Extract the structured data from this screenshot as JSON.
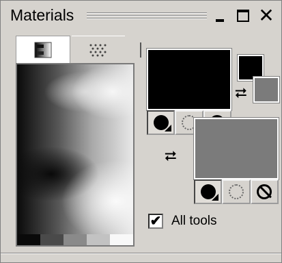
{
  "window": {
    "title": "Materials",
    "min_label": "",
    "close_label": "✕"
  },
  "tabs": [
    {
      "name": "gradient",
      "icon": "gradient-icon",
      "active": true
    },
    {
      "name": "pattern",
      "icon": "pattern-icon",
      "active": false
    }
  ],
  "gradient": {
    "swatches": [
      "#0a0a0a",
      "#4a4a4a",
      "#8a8a8a",
      "#c2c2c2",
      "#f8f8f8"
    ]
  },
  "foreground": {
    "color": "#000000",
    "tools": [
      {
        "name": "solid-color",
        "icon": "solid-circle-icon",
        "active": true
      },
      {
        "name": "gradient",
        "icon": "speckle-icon",
        "active": false
      },
      {
        "name": "none",
        "icon": "no-icon",
        "active": false
      }
    ]
  },
  "background": {
    "color": "#7b7b7b",
    "tools": [
      {
        "name": "solid-color",
        "icon": "solid-circle-icon",
        "active": true
      },
      {
        "name": "gradient",
        "icon": "speckle-icon",
        "active": false
      },
      {
        "name": "none",
        "icon": "no-icon",
        "active": false
      }
    ]
  },
  "swap_icon": "⮂",
  "all_tools": {
    "checked": true,
    "check_mark": "✔",
    "label": "All tools"
  }
}
